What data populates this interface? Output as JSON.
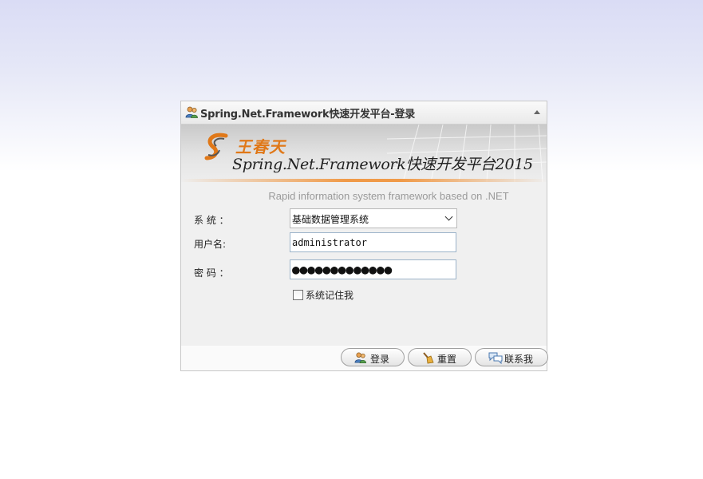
{
  "window": {
    "title": "Spring.Net.Framework快速开发平台-登录"
  },
  "banner": {
    "brand": "王春天",
    "product": "Spring.Net.Framework快速开发平台2015"
  },
  "subtitle": "Rapid information system framework based on .NET",
  "form": {
    "system_label": "系 统 ：",
    "system_value": "基础数据管理系统",
    "username_label": "用户名:",
    "username_value": "administrator",
    "password_label": "密 码 ：",
    "password_value": "●●●●●●●●●●●●●",
    "remember_label": "系统记住我"
  },
  "buttons": {
    "login": "登录",
    "reset": "重置",
    "contact": "联系我"
  },
  "colors": {
    "accent_orange": "#e07818",
    "input_border": "#9bb3c9"
  }
}
